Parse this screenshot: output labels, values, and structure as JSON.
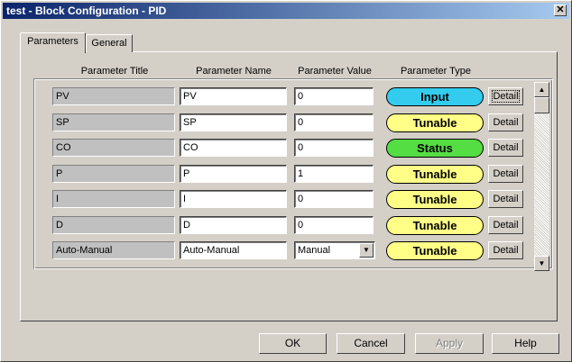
{
  "window": {
    "title": "test - Block Configuration - PID",
    "close_glyph": "✕"
  },
  "tabs": [
    {
      "label": "Parameters",
      "active": true
    },
    {
      "label": "General",
      "active": false
    }
  ],
  "columns": {
    "title": "Parameter Title",
    "name": "Parameter Name",
    "value": "Parameter Value",
    "type": "Parameter Type"
  },
  "rows": [
    {
      "title": "PV",
      "name": "PV",
      "value": "0",
      "type": "Input",
      "detail": "Detail"
    },
    {
      "title": "SP",
      "name": "SP",
      "value": "0",
      "type": "Tunable",
      "detail": "Detail"
    },
    {
      "title": "CO",
      "name": "CO",
      "value": "0",
      "type": "Status",
      "detail": "Detail"
    },
    {
      "title": "P",
      "name": "P",
      "value": "1",
      "type": "Tunable",
      "detail": "Detail"
    },
    {
      "title": "I",
      "name": "I",
      "value": "0",
      "type": "Tunable",
      "detail": "Detail"
    },
    {
      "title": "D",
      "name": "D",
      "value": "0",
      "type": "Tunable",
      "detail": "Detail"
    },
    {
      "title": "Auto-Manual",
      "name": "Auto-Manual",
      "value": "Manual",
      "type": "Tunable",
      "detail": "Detail",
      "dropdown": true
    }
  ],
  "type_colors": {
    "Input": "#33ccee",
    "Tunable": "#ffff88",
    "Status": "#55dd44"
  },
  "buttons": {
    "ok": "OK",
    "cancel": "Cancel",
    "apply": "Apply",
    "help": "Help"
  }
}
